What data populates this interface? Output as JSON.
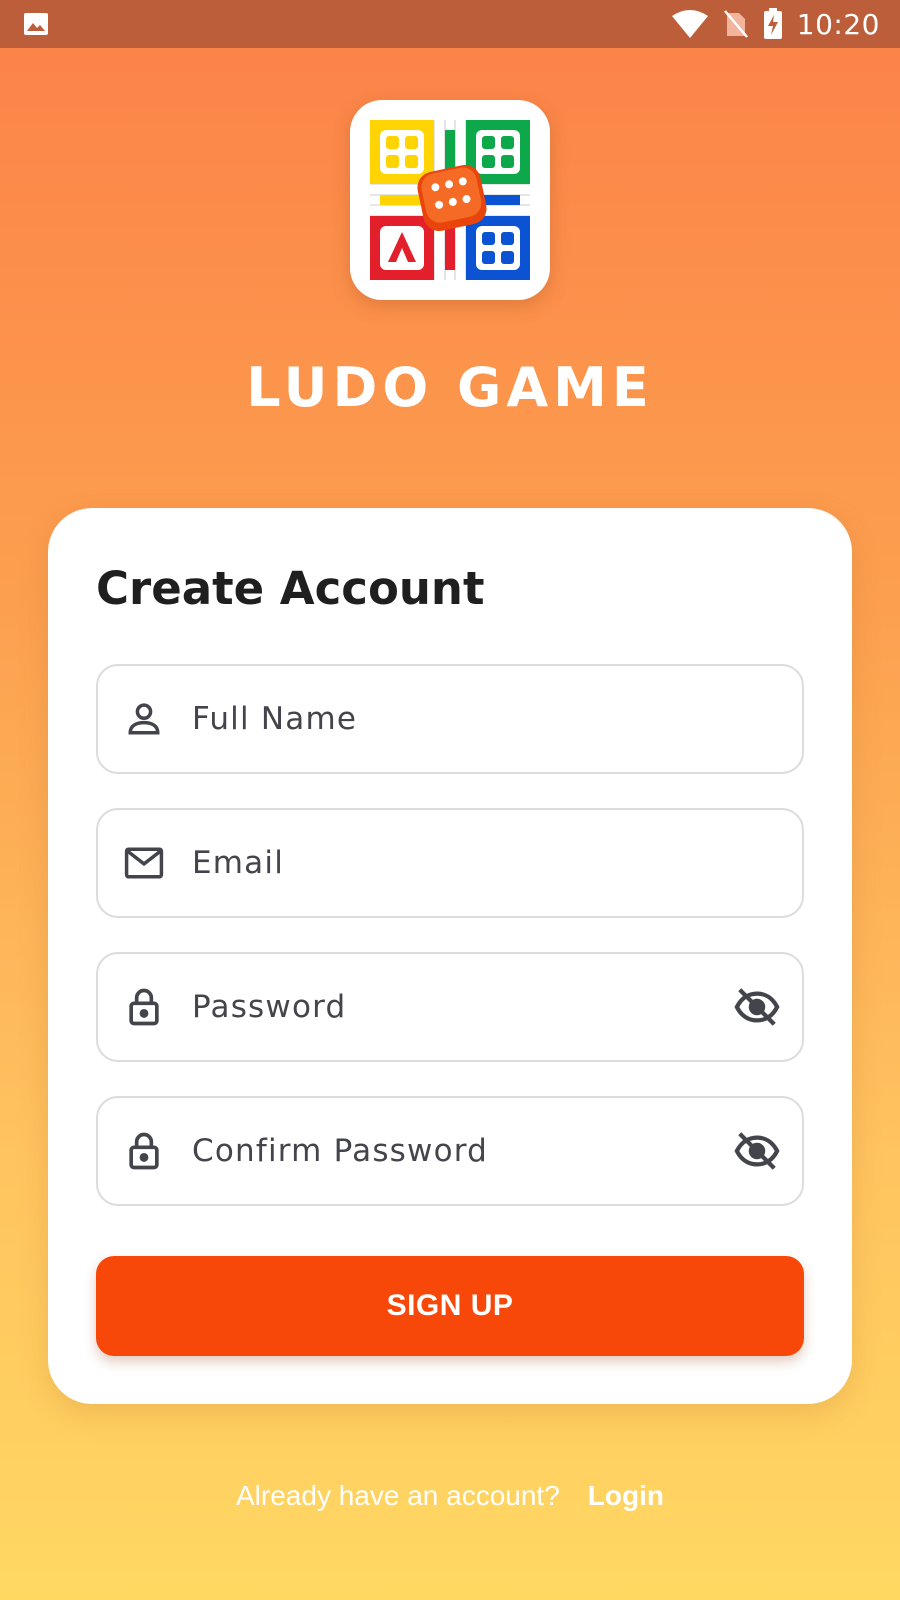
{
  "status_bar": {
    "time": "10:20",
    "icons": [
      "image-icon",
      "wifi-icon",
      "no-sim-icon",
      "battery-charging-icon"
    ]
  },
  "app": {
    "logo": "ludo-board-logo",
    "title": "LUDO GAME"
  },
  "form": {
    "title": "Create Account",
    "fields": [
      {
        "placeholder": "Full Name",
        "icon": "person-icon"
      },
      {
        "placeholder": "Email",
        "icon": "mail-icon"
      },
      {
        "placeholder": "Password",
        "icon": "lock-icon",
        "trailing_icon": "visibility-off-icon"
      },
      {
        "placeholder": "Confirm Password",
        "icon": "lock-icon",
        "trailing_icon": "visibility-off-icon"
      }
    ],
    "submit_label": "SIGN UP"
  },
  "footer": {
    "prompt": "Already have an account?",
    "link_label": "Login"
  },
  "colors": {
    "accent": "#f7480a",
    "status_bar": "#bd5e3b",
    "gradient_top": "#fc8148",
    "gradient_bottom": "#ffd862"
  }
}
